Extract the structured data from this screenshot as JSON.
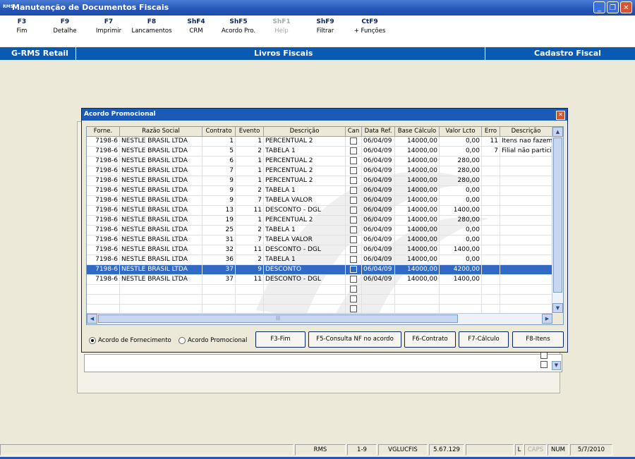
{
  "window": {
    "icon_text": "RMS",
    "title": "Manutenção de Documentos Fiscais"
  },
  "toolbar": [
    {
      "key": "F3",
      "label": "Fim",
      "enabled": true
    },
    {
      "key": "F9",
      "label": "Detalhe",
      "enabled": true
    },
    {
      "key": "F7",
      "label": "Imprimir",
      "enabled": true
    },
    {
      "key": "F8",
      "label": "Lancamentos",
      "enabled": true
    },
    {
      "key": "ShF4",
      "label": "CRM",
      "enabled": true
    },
    {
      "key": "ShF5",
      "label": "Acordo Pro.",
      "enabled": true
    },
    {
      "key": "ShF1",
      "label": "Help",
      "enabled": false
    },
    {
      "key": "ShF9",
      "label": "Filtrar",
      "enabled": true
    },
    {
      "key": "CtF9",
      "label": "+ Funções",
      "enabled": true
    }
  ],
  "section_bar": {
    "left": "G-RMS Retail",
    "center": "Livros Fiscais",
    "right": "Cadastro Fiscal"
  },
  "dialog": {
    "title": "Acordo Promocional",
    "columns": [
      "Forne.",
      "Razão Social",
      "Contrato",
      "Evento",
      "Descrição",
      "Can",
      "Data Ref.",
      "Base Cálculo",
      "Valor Lcto",
      "Erro",
      "Descrição"
    ],
    "rows": [
      {
        "forne": "7198-6",
        "razao": "NESTLE BRASIL LTDA",
        "contrato": "1",
        "evento": "1",
        "descricao": "PERCENTUAL 2",
        "data": "06/04/09",
        "base": "14000,00",
        "valor": "0,00",
        "erro": "11",
        "erro_desc": "Itens nao fazem"
      },
      {
        "forne": "7198-6",
        "razao": "NESTLE BRASIL LTDA",
        "contrato": "5",
        "evento": "2",
        "descricao": "TABELA 1",
        "data": "06/04/09",
        "base": "14000,00",
        "valor": "0,00",
        "erro": "7",
        "erro_desc": "Filial não particip"
      },
      {
        "forne": "7198-6",
        "razao": "NESTLE BRASIL LTDA",
        "contrato": "6",
        "evento": "1",
        "descricao": "PERCENTUAL 2",
        "data": "06/04/09",
        "base": "14000,00",
        "valor": "280,00",
        "erro": "",
        "erro_desc": ""
      },
      {
        "forne": "7198-6",
        "razao": "NESTLE BRASIL LTDA",
        "contrato": "7",
        "evento": "1",
        "descricao": "PERCENTUAL 2",
        "data": "06/04/09",
        "base": "14000,00",
        "valor": "280,00",
        "erro": "",
        "erro_desc": ""
      },
      {
        "forne": "7198-6",
        "razao": "NESTLE BRASIL LTDA",
        "contrato": "9",
        "evento": "1",
        "descricao": "PERCENTUAL 2",
        "data": "06/04/09",
        "base": "14000,00",
        "valor": "280,00",
        "erro": "",
        "erro_desc": ""
      },
      {
        "forne": "7198-6",
        "razao": "NESTLE BRASIL LTDA",
        "contrato": "9",
        "evento": "2",
        "descricao": "TABELA 1",
        "data": "06/04/09",
        "base": "14000,00",
        "valor": "0,00",
        "erro": "",
        "erro_desc": ""
      },
      {
        "forne": "7198-6",
        "razao": "NESTLE BRASIL LTDA",
        "contrato": "9",
        "evento": "7",
        "descricao": "TABELA VALOR",
        "data": "06/04/09",
        "base": "14000,00",
        "valor": "0,00",
        "erro": "",
        "erro_desc": ""
      },
      {
        "forne": "7198-6",
        "razao": "NESTLE BRASIL LTDA",
        "contrato": "13",
        "evento": "11",
        "descricao": "DESCONTO - DGL",
        "data": "06/04/09",
        "base": "14000,00",
        "valor": "1400,00",
        "erro": "",
        "erro_desc": ""
      },
      {
        "forne": "7198-6",
        "razao": "NESTLE BRASIL LTDA",
        "contrato": "19",
        "evento": "1",
        "descricao": "PERCENTUAL 2",
        "data": "06/04/09",
        "base": "14000,00",
        "valor": "280,00",
        "erro": "",
        "erro_desc": ""
      },
      {
        "forne": "7198-6",
        "razao": "NESTLE BRASIL LTDA",
        "contrato": "25",
        "evento": "2",
        "descricao": "TABELA 1",
        "data": "06/04/09",
        "base": "14000,00",
        "valor": "0,00",
        "erro": "",
        "erro_desc": ""
      },
      {
        "forne": "7198-6",
        "razao": "NESTLE BRASIL LTDA",
        "contrato": "31",
        "evento": "7",
        "descricao": "TABELA VALOR",
        "data": "06/04/09",
        "base": "14000,00",
        "valor": "0,00",
        "erro": "",
        "erro_desc": ""
      },
      {
        "forne": "7198-6",
        "razao": "NESTLE BRASIL LTDA",
        "contrato": "32",
        "evento": "11",
        "descricao": "DESCONTO - DGL",
        "data": "06/04/09",
        "base": "14000,00",
        "valor": "1400,00",
        "erro": "",
        "erro_desc": ""
      },
      {
        "forne": "7198-6",
        "razao": "NESTLE BRASIL LTDA",
        "contrato": "36",
        "evento": "2",
        "descricao": "TABELA 1",
        "data": "06/04/09",
        "base": "14000,00",
        "valor": "0,00",
        "erro": "",
        "erro_desc": ""
      },
      {
        "forne": "7198-6",
        "razao": "NESTLE BRASIL LTDA",
        "contrato": "37",
        "evento": "9",
        "descricao": "DESCONTO",
        "data": "06/04/09",
        "base": "14000,00",
        "valor": "4200,00",
        "erro": "",
        "erro_desc": "",
        "selected": true
      },
      {
        "forne": "7198-6",
        "razao": "NESTLE BRASIL LTDA",
        "contrato": "37",
        "evento": "11",
        "descricao": "DESCONTO - DGL",
        "data": "06/04/09",
        "base": "14000,00",
        "valor": "1400,00",
        "erro": "",
        "erro_desc": ""
      }
    ],
    "empty_rows": 3,
    "radio": {
      "option1": "Acordo de Fornecimento",
      "option2": "Acordo Promocional",
      "selected": "option1"
    },
    "buttons": {
      "f3": "F3-Fim",
      "f5": "F5-Consulta NF no acordo",
      "f6": "F6-Contrato",
      "f7": "F7-Cálculo",
      "f8": "F8-Itens"
    }
  },
  "statusbar": [
    "RMS",
    "1-9",
    "VGLUCFIS",
    "5.67.129",
    "L",
    "CAPS",
    "NUM",
    "5/7/2010"
  ],
  "colors": {
    "selection": "#316ac5",
    "section_bar": "#0a5ab4",
    "title_bar": "#2456b8"
  }
}
